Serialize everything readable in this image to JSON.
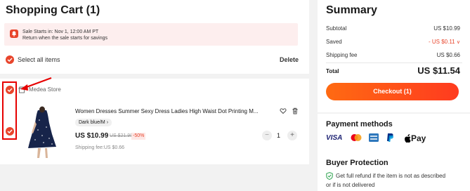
{
  "cart": {
    "title": "Shopping Cart (1)",
    "sale_line1": "Sale Starts in: Nov 1, 12:00 AM PT",
    "sale_line2": "Return when the sale starts for savings",
    "select_all": "Select all items",
    "delete": "Delete"
  },
  "store": {
    "name": "Medea Store",
    "item": {
      "title": "Women Dresses Summer Sexy Dress Ladies High Waist Dot Printing M...",
      "variant": "Dark blue/M",
      "price": "US $10.99",
      "old_price": "US $21.98",
      "discount": "-50%",
      "shipping": "Shipping fee:US $0.66",
      "quantity": "1",
      "qty_minus": "−",
      "qty_plus": "+"
    }
  },
  "summary": {
    "title": "Summary",
    "subtotal_label": "Subtotal",
    "subtotal_value": "US $10.99",
    "saved_label": "Saved",
    "saved_value": "- US $0.11",
    "shipping_label": "Shipping fee",
    "shipping_value": "US $0.66",
    "total_label": "Total",
    "total_value": "US $11.54",
    "checkout": "Checkout (1)"
  },
  "payment": {
    "title": "Payment methods",
    "visa": "VISA",
    "applepay": "Pay",
    "buyer_title": "Buyer Protection",
    "buyer_line1": "Get full refund if the item is not as described",
    "buyer_line2": "or if is not delivered"
  },
  "icons": {
    "checkbox": "check-circle-icon",
    "bell": "bell-icon",
    "store": "store-icon",
    "heart": "heart-icon",
    "trash": "trash-icon",
    "shield": "shield-check-icon",
    "mastercard": "mastercard-icon",
    "amex": "amex-icon",
    "paypal": "paypal-icon",
    "apple": "apple-icon"
  },
  "colors": {
    "accent": "#e8452c",
    "checkout_start": "#ff6a12",
    "checkout_end": "#ff3b1f",
    "annotation": "#e60000"
  }
}
